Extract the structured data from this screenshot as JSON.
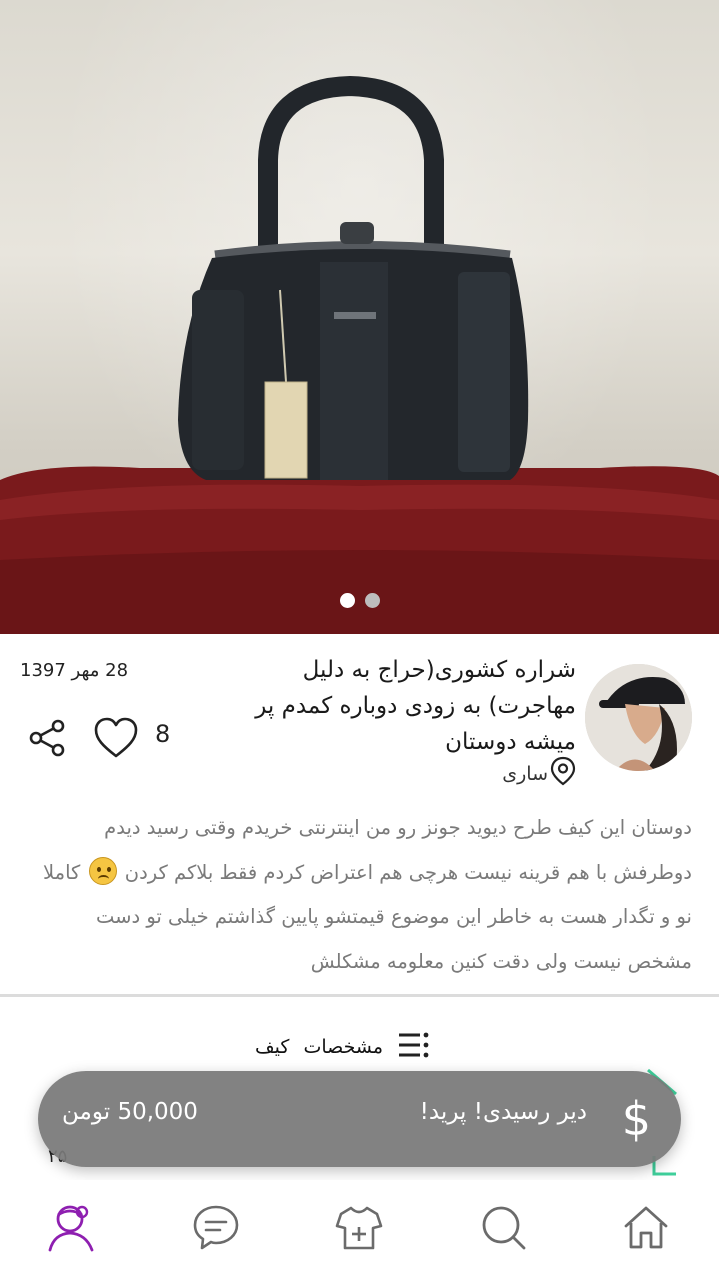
{
  "listing": {
    "title": "شراره کشوری(حراج به دلیل مهاجرت) به زودی دوباره کمدم پر میشه دوستان",
    "location": "ساری",
    "date": "28 مهر 1397",
    "likes": "8",
    "description_part1": "دوستان این کیف طرح دیوید جونز رو من اینترنتی خریدم وقتی رسید دیدم دوطرفش با هم قرینه نیست هرچی هم اعتراض کردم فقط بلاکم کردن",
    "description_part2": "کاملا نو و تگدار هست به خاطر این موضوع قیمتشو پایین گذاشتم خیلی تو دست مشخص نیست ولی دقت کنین معلومه مشکلش",
    "emoji": "sad-face",
    "image_count": 2,
    "active_image": 1
  },
  "specs": {
    "label": "مشخصات",
    "value": "کیف"
  },
  "price_bar": {
    "status": "دیر رسیدی! پرید!",
    "price": "50,000 تومن",
    "icon": "dollar-icon"
  },
  "peek": {
    "left_text": "۲۵"
  },
  "bottom_nav": {
    "items": [
      {
        "name": "home",
        "icon": "home-icon"
      },
      {
        "name": "search",
        "icon": "search-icon"
      },
      {
        "name": "add",
        "icon": "add-shirt-icon"
      },
      {
        "name": "chat",
        "icon": "chat-icon"
      },
      {
        "name": "profile",
        "icon": "profile-icon",
        "active": true
      }
    ]
  },
  "colors": {
    "accent": "#8e1fb0",
    "price_bar_bg": "#7a7a7a",
    "description_text": "#7a7a7a",
    "icon_gray": "#6b6b6b",
    "teal_accent": "#3fcf9b"
  }
}
